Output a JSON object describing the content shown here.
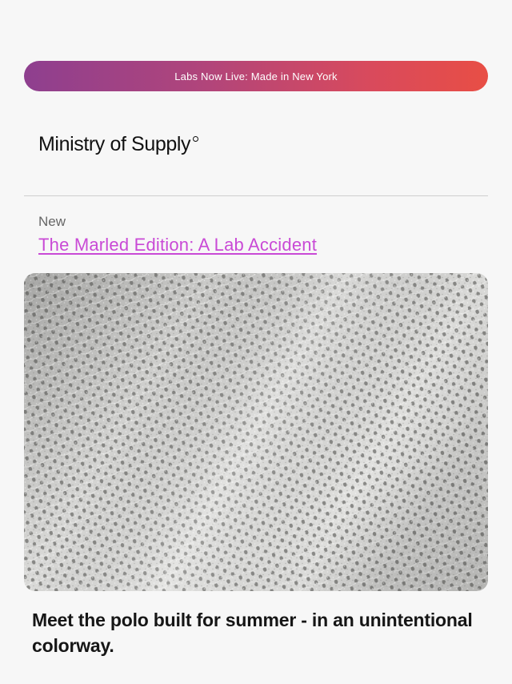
{
  "banner": {
    "text": "Labs Now Live: Made in New York"
  },
  "brand": {
    "name": "Ministry of Supply"
  },
  "feature": {
    "eyebrow": "New",
    "title": "The Marled Edition: A Lab Accident",
    "image_subject": "knit-fabric-texture",
    "caption": "Meet the polo built for summer - in an unintentional colorway."
  },
  "colors": {
    "banner_gradient_start": "#8e3f8f",
    "banner_gradient_end": "#e84e45",
    "link_accent": "#c94ad6",
    "background": "#f7f7f7",
    "divider": "#cfcfcf"
  }
}
